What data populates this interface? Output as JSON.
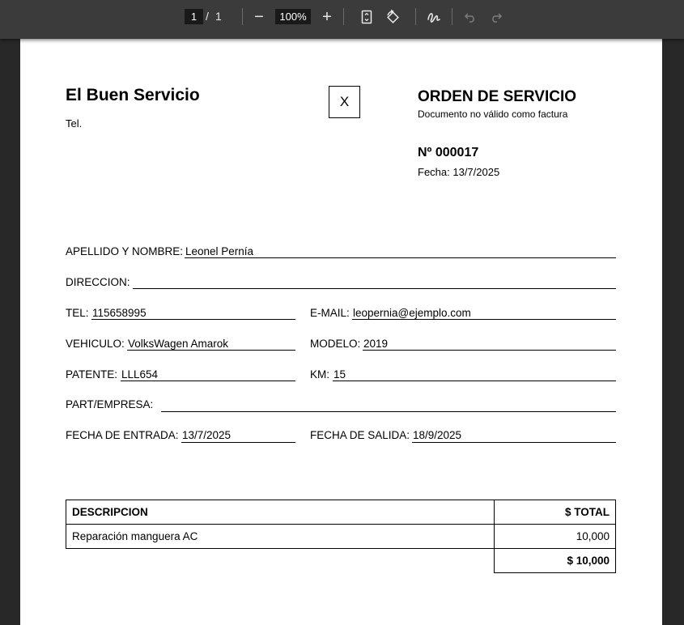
{
  "toolbar": {
    "page_current": "1",
    "page_separator": "/",
    "page_total": "1",
    "zoom_out": "−",
    "zoom_value": "100%",
    "zoom_in": "+"
  },
  "document": {
    "company_name": "El Buen Servicio",
    "company_tel": "Tel.",
    "type_box": "X",
    "title": "ORDEN DE SERVICIO",
    "subtitle": "Documento no válido como factura",
    "number": "Nº 000017",
    "date": "Fecha: 13/7/2025"
  },
  "fields": {
    "name_label": "APELLIDO Y NOMBRE:",
    "name_value": "Leonel Pernía",
    "address_label": "DIRECCION:",
    "address_value": "",
    "tel_label": "TEL:",
    "tel_value": "115658995",
    "email_label": "E-MAIL:",
    "email_value": "leopernia@ejemplo.com",
    "vehicle_label": "VEHICULO:",
    "vehicle_value": "VolksWagen Amarok",
    "model_label": "MODELO:",
    "model_value": "2019",
    "plate_label": "PATENTE:",
    "plate_value": "LLL654",
    "km_label": "KM:",
    "km_value": "15",
    "company_label": "PART/EMPRESA:",
    "company_value": "",
    "entry_label": "FECHA DE ENTRADA:",
    "entry_value": "13/7/2025",
    "exit_label": "FECHA DE SALIDA:",
    "exit_value": "18/9/2025"
  },
  "table": {
    "headers": [
      "DESCRIPCION",
      "$ TOTAL"
    ],
    "rows": [
      {
        "description": "Reparación manguera AC",
        "total": "10,000"
      }
    ],
    "grand_total": "$ 10,000"
  },
  "icons": {
    "fit_page": "fit-page-icon",
    "rotate": "rotate-icon",
    "draw": "draw-icon",
    "undo": "undo-icon",
    "redo": "redo-icon"
  },
  "colors": {
    "toolbar_bg": "#3b3b3b",
    "viewer_bg": "#282828",
    "paper": "#ffffff"
  }
}
